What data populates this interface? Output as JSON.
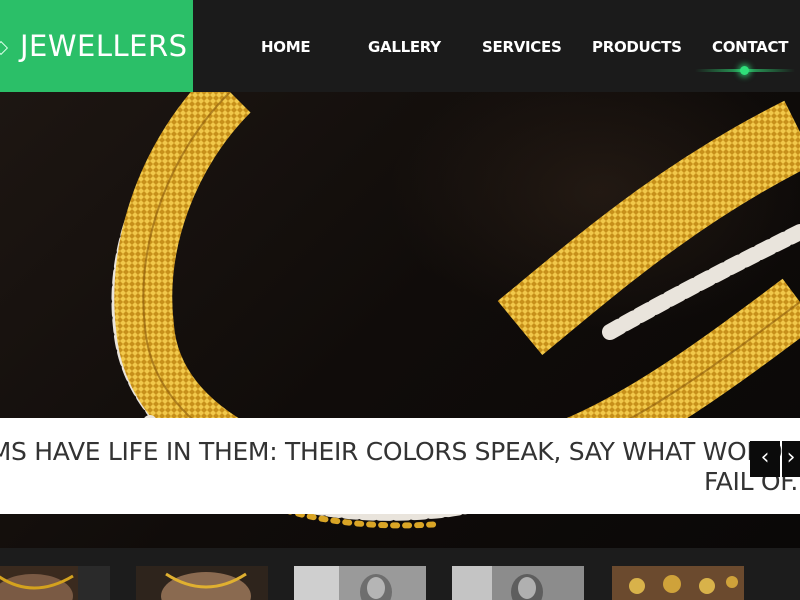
{
  "brand": {
    "name": "JEWELLERS"
  },
  "nav": {
    "items": [
      {
        "label": "HOME"
      },
      {
        "label": "GALLERY"
      },
      {
        "label": "SERVICES"
      },
      {
        "label": "PRODUCTS"
      },
      {
        "label": "CONTACT"
      }
    ],
    "active_index": 4
  },
  "slider": {
    "caption_line1": "ESE GEMS HAVE LIFE IN THEM: THEIR COLORS SPEAK, SAY WHAT WORDS",
    "caption_line2": "FAIL OF.",
    "prev_label": "‹",
    "next_label": "›"
  },
  "colors": {
    "accent": "#2bbf68",
    "header_bg": "#1b1b1b",
    "gold": "#d4a21e"
  },
  "thumbnails": [
    {
      "name": "thumb-necklace-model-1"
    },
    {
      "name": "thumb-necklace-model-2"
    },
    {
      "name": "thumb-bride-portrait-1"
    },
    {
      "name": "thumb-bride-portrait-2"
    },
    {
      "name": "thumb-jewellery-set"
    }
  ]
}
